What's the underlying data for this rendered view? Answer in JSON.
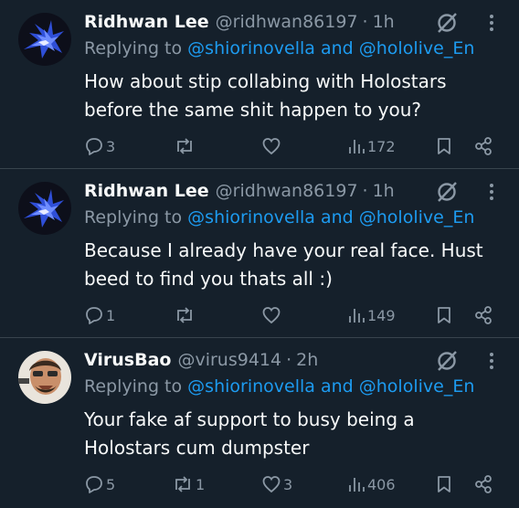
{
  "tweets": [
    {
      "name": "Ridhwan Lee",
      "handle": "@ridhwan86197",
      "dot": "·",
      "time": "1h",
      "replying_prefix": "Replying to",
      "mention_1": "@shiorinovella",
      "and": "and",
      "mention_2": "@hololive_En",
      "text": "How about stip collabing with Holostars before the same shit happen to you?",
      "replies": "3",
      "reposts": "",
      "likes": "",
      "views": "172",
      "avatar": "blue-bird-avatar"
    },
    {
      "name": "Ridhwan Lee",
      "handle": "@ridhwan86197",
      "dot": "·",
      "time": "1h",
      "replying_prefix": "Replying to",
      "mention_1": "@shiorinovella",
      "and": "and",
      "mention_2": "@hololive_En",
      "text": "Because I already have your real face. Hust beed to find you thats all :)",
      "replies": "1",
      "reposts": "",
      "likes": "",
      "views": "149",
      "avatar": "blue-bird-avatar"
    },
    {
      "name": "VirusBao",
      "handle": "@virus9414",
      "dot": "·",
      "time": "2h",
      "replying_prefix": "Replying to",
      "mention_1": "@shiorinovella",
      "and": "and",
      "mention_2": "@hololive_En",
      "text": "Your fake af support to busy being a Holostars cum dumpster",
      "replies": "5",
      "reposts": "1",
      "likes": "3",
      "views": "406",
      "avatar": "cartoon-face-avatar"
    }
  ],
  "colors": {
    "background": "#15202b",
    "text": "#f7f9f9",
    "muted": "#8b98a5",
    "link": "#1d9bf0",
    "divider": "#38444d"
  },
  "icons": [
    "reply-icon",
    "repost-icon",
    "like-icon",
    "views-icon",
    "bookmark-icon",
    "share-icon",
    "grok-icon",
    "more-icon"
  ]
}
